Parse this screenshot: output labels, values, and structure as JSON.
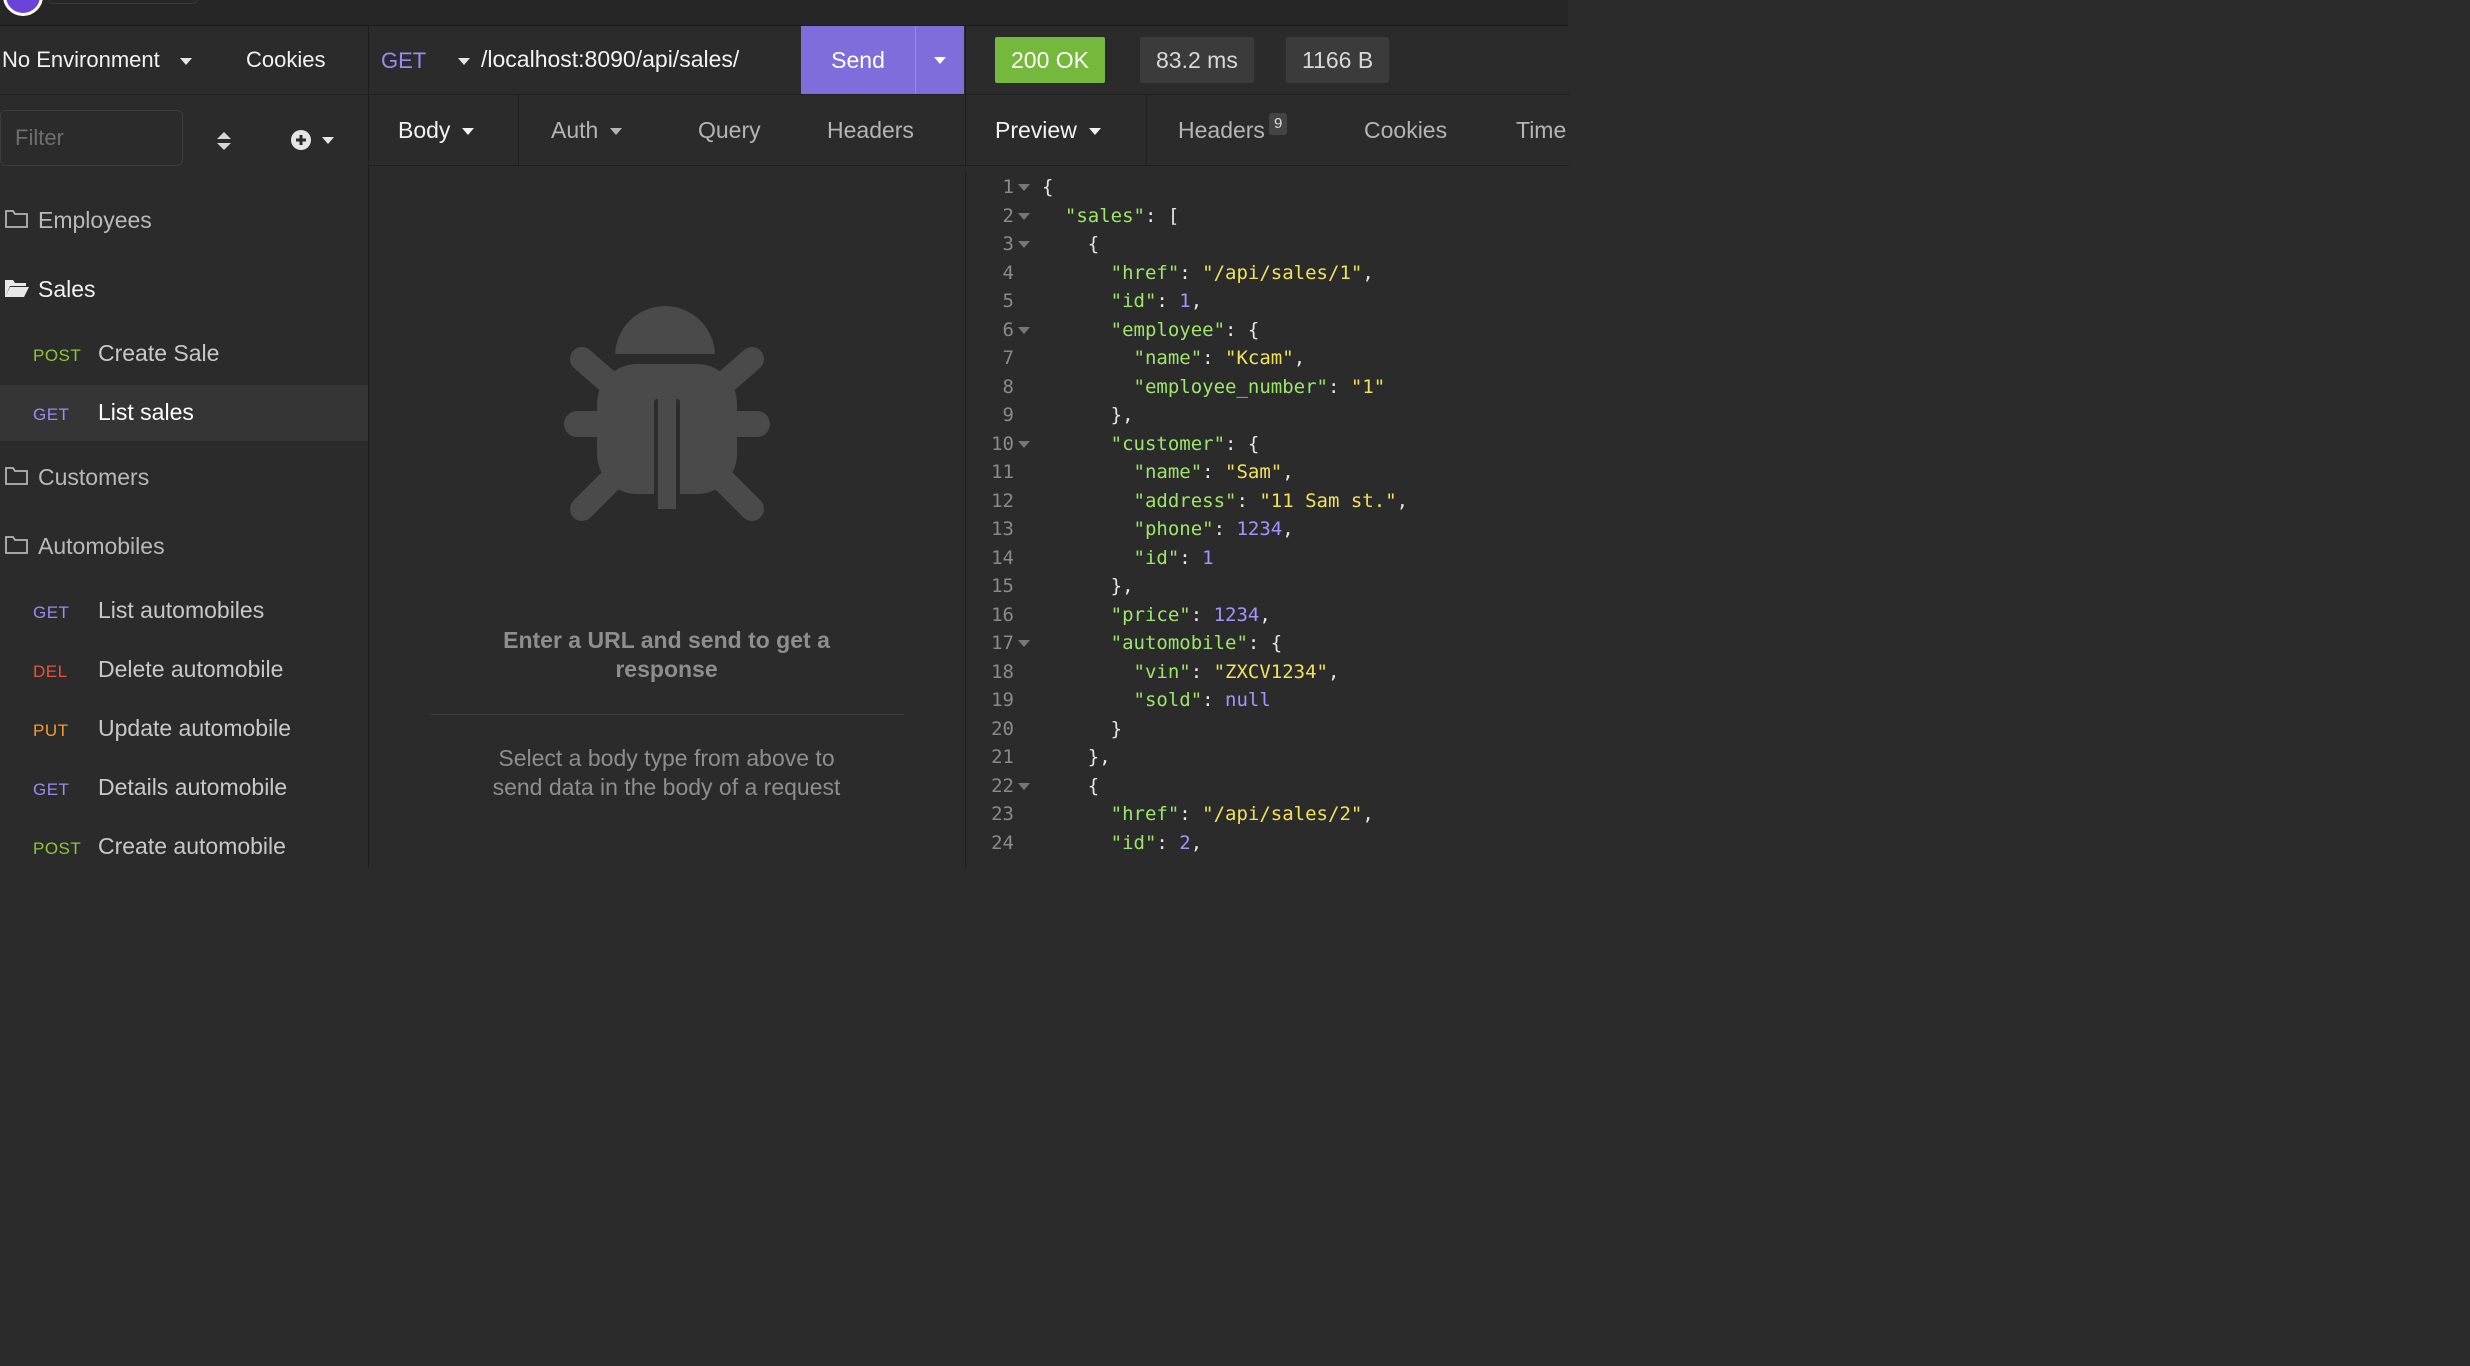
{
  "colors": {
    "accent": "#7f6ddb",
    "status_ok": "#74b93b",
    "method_get": "#9a8cf0",
    "method_post": "#8fc63b",
    "method_del": "#e5553d",
    "method_put": "#f39b2c",
    "json_key": "#9ee66a",
    "json_string": "#f0e35a",
    "json_number": "#a394ff"
  },
  "sidebar": {
    "environment": "No Environment",
    "cookies": "Cookies",
    "filter_placeholder": "Filter",
    "items": [
      {
        "type": "folder",
        "label": "Employees",
        "open": false
      },
      {
        "type": "folder",
        "label": "Sales",
        "open": true
      },
      {
        "type": "request",
        "method": "POST",
        "label": "Create Sale"
      },
      {
        "type": "request",
        "method": "GET",
        "label": "List sales",
        "active": true
      },
      {
        "type": "folder",
        "label": "Customers",
        "open": false
      },
      {
        "type": "folder",
        "label": "Automobiles",
        "open": false
      },
      {
        "type": "request",
        "method": "GET",
        "label": "List automobiles"
      },
      {
        "type": "request",
        "method": "DEL",
        "label": "Delete automobile"
      },
      {
        "type": "request",
        "method": "PUT",
        "label": "Update automobile"
      },
      {
        "type": "request",
        "method": "GET",
        "label": "Details automobile"
      },
      {
        "type": "request",
        "method": "POST",
        "label": "Create automobile"
      }
    ]
  },
  "request": {
    "method": "GET",
    "url": "/localhost:8090/api/sales/",
    "send_label": "Send",
    "tabs": [
      "Body",
      "Auth",
      "Query",
      "Headers"
    ],
    "empty_title": "Enter a URL and send to get a response",
    "empty_hint": "Select a body type from above to send data in the body of a request"
  },
  "response": {
    "status": "200 OK",
    "time": "83.2 ms",
    "size": "1166 B",
    "tabs": [
      "Preview",
      "Headers",
      "Cookies",
      "Time"
    ],
    "headers_count": "9",
    "lines": [
      {
        "n": "1",
        "fold": true,
        "t": [
          [
            "p",
            "{"
          ]
        ]
      },
      {
        "n": "2",
        "fold": true,
        "t": [
          [
            "p",
            "  "
          ],
          [
            "k",
            "\"sales\""
          ],
          [
            "p",
            ": ["
          ]
        ]
      },
      {
        "n": "3",
        "fold": true,
        "t": [
          [
            "p",
            "    {"
          ]
        ]
      },
      {
        "n": "4",
        "fold": false,
        "t": [
          [
            "p",
            "      "
          ],
          [
            "k",
            "\"href\""
          ],
          [
            "p",
            ": "
          ],
          [
            "s",
            "\"/api/sales/1\""
          ],
          [
            "p",
            ","
          ]
        ]
      },
      {
        "n": "5",
        "fold": false,
        "t": [
          [
            "p",
            "      "
          ],
          [
            "k",
            "\"id\""
          ],
          [
            "p",
            ": "
          ],
          [
            "n",
            "1"
          ],
          [
            "p",
            ","
          ]
        ]
      },
      {
        "n": "6",
        "fold": true,
        "t": [
          [
            "p",
            "      "
          ],
          [
            "k",
            "\"employee\""
          ],
          [
            "p",
            ": {"
          ]
        ]
      },
      {
        "n": "7",
        "fold": false,
        "t": [
          [
            "p",
            "        "
          ],
          [
            "k",
            "\"name\""
          ],
          [
            "p",
            ": "
          ],
          [
            "s",
            "\"Kcam\""
          ],
          [
            "p",
            ","
          ]
        ]
      },
      {
        "n": "8",
        "fold": false,
        "t": [
          [
            "p",
            "        "
          ],
          [
            "k",
            "\"employee_number\""
          ],
          [
            "p",
            ": "
          ],
          [
            "s",
            "\"1\""
          ]
        ]
      },
      {
        "n": "9",
        "fold": false,
        "t": [
          [
            "p",
            "      },"
          ]
        ]
      },
      {
        "n": "10",
        "fold": true,
        "t": [
          [
            "p",
            "      "
          ],
          [
            "k",
            "\"customer\""
          ],
          [
            "p",
            ": {"
          ]
        ]
      },
      {
        "n": "11",
        "fold": false,
        "t": [
          [
            "p",
            "        "
          ],
          [
            "k",
            "\"name\""
          ],
          [
            "p",
            ": "
          ],
          [
            "s",
            "\"Sam\""
          ],
          [
            "p",
            ","
          ]
        ]
      },
      {
        "n": "12",
        "fold": false,
        "t": [
          [
            "p",
            "        "
          ],
          [
            "k",
            "\"address\""
          ],
          [
            "p",
            ": "
          ],
          [
            "s",
            "\"11 Sam st.\""
          ],
          [
            "p",
            ","
          ]
        ]
      },
      {
        "n": "13",
        "fold": false,
        "t": [
          [
            "p",
            "        "
          ],
          [
            "k",
            "\"phone\""
          ],
          [
            "p",
            ": "
          ],
          [
            "n",
            "1234"
          ],
          [
            "p",
            ","
          ]
        ]
      },
      {
        "n": "14",
        "fold": false,
        "t": [
          [
            "p",
            "        "
          ],
          [
            "k",
            "\"id\""
          ],
          [
            "p",
            ": "
          ],
          [
            "n",
            "1"
          ]
        ]
      },
      {
        "n": "15",
        "fold": false,
        "t": [
          [
            "p",
            "      },"
          ]
        ]
      },
      {
        "n": "16",
        "fold": false,
        "t": [
          [
            "p",
            "      "
          ],
          [
            "k",
            "\"price\""
          ],
          [
            "p",
            ": "
          ],
          [
            "n",
            "1234"
          ],
          [
            "p",
            ","
          ]
        ]
      },
      {
        "n": "17",
        "fold": true,
        "t": [
          [
            "p",
            "      "
          ],
          [
            "k",
            "\"automobile\""
          ],
          [
            "p",
            ": {"
          ]
        ]
      },
      {
        "n": "18",
        "fold": false,
        "t": [
          [
            "p",
            "        "
          ],
          [
            "k",
            "\"vin\""
          ],
          [
            "p",
            ": "
          ],
          [
            "s",
            "\"ZXCV1234\""
          ],
          [
            "p",
            ","
          ]
        ]
      },
      {
        "n": "19",
        "fold": false,
        "t": [
          [
            "p",
            "        "
          ],
          [
            "k",
            "\"sold\""
          ],
          [
            "p",
            ": "
          ],
          [
            "n",
            "null"
          ]
        ]
      },
      {
        "n": "20",
        "fold": false,
        "t": [
          [
            "p",
            "      }"
          ]
        ]
      },
      {
        "n": "21",
        "fold": false,
        "t": [
          [
            "p",
            "    },"
          ]
        ]
      },
      {
        "n": "22",
        "fold": true,
        "t": [
          [
            "p",
            "    {"
          ]
        ]
      },
      {
        "n": "23",
        "fold": false,
        "t": [
          [
            "p",
            "      "
          ],
          [
            "k",
            "\"href\""
          ],
          [
            "p",
            ": "
          ],
          [
            "s",
            "\"/api/sales/2\""
          ],
          [
            "p",
            ","
          ]
        ]
      },
      {
        "n": "24",
        "fold": false,
        "t": [
          [
            "p",
            "      "
          ],
          [
            "k",
            "\"id\""
          ],
          [
            "p",
            ": "
          ],
          [
            "n",
            "2"
          ],
          [
            "p",
            ","
          ]
        ]
      }
    ]
  }
}
